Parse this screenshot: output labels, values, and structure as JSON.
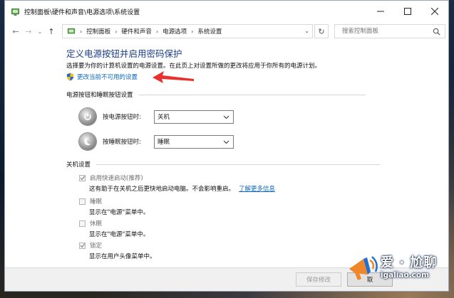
{
  "window": {
    "title": "控制面板\\硬件和声音\\电源选项\\系统设置",
    "controls": {
      "minimize": "—",
      "maximize": "☐",
      "close": "✕"
    }
  },
  "nav": {
    "back": "←",
    "forward": "→",
    "dropdown": "⌄",
    "up": "↑",
    "breadcrumbs": [
      "控制面板",
      "硬件和声音",
      "电源选项",
      "系统设置"
    ],
    "separator": "›",
    "refresh": "↻",
    "search_placeholder": "搜索控制面板"
  },
  "page": {
    "heading": "定义电源按钮并启用密码保护",
    "intro": "选择要为你的计算机设置的电源设置。在此页上对设置所做的更改将应用于你所有的电源计划。",
    "admin_link": "更改当前不可用的设置",
    "power_section": {
      "title": "电源按钮和睡眠按钮设置",
      "power_button_label": "按电源按钮时:",
      "power_button_value": "关机",
      "sleep_button_label": "按睡眠按钮时:",
      "sleep_button_value": "睡眠"
    },
    "shutdown_section": {
      "title": "关机设置",
      "items": [
        {
          "label": "启用快速启动(推荐)",
          "checked": true,
          "desc": "这有助于在关机之后更快地启动电脑。不会影响重启。",
          "link": "了解更多信息"
        },
        {
          "label": "睡眠",
          "checked": false,
          "desc": "显示在\"电源\"菜单中。"
        },
        {
          "label": "休眠",
          "checked": false,
          "desc": "显示在\"电源\"菜单中。"
        },
        {
          "label": "锁定",
          "checked": true,
          "desc": "显示在用户头像菜单中。"
        }
      ]
    }
  },
  "footer": {
    "save_label": "保存修改",
    "cancel_label": "取"
  },
  "watermark": {
    "title": "爱 · 尬聊",
    "domain": "igaliao.com"
  },
  "colors": {
    "heading": "#1b3d8c",
    "link": "#0a66c2",
    "arrow": "#e8312f"
  }
}
